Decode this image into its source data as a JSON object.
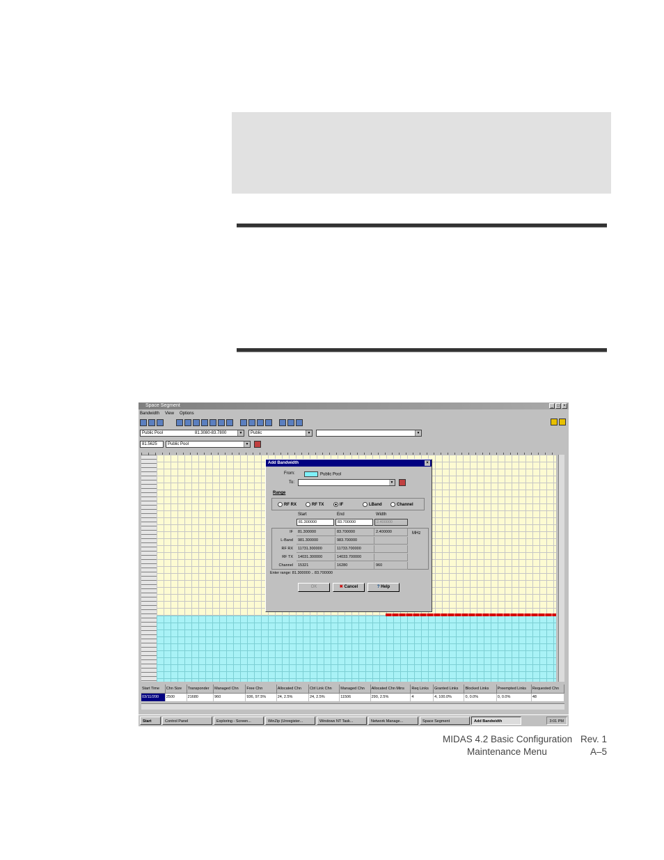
{
  "screenshot": {
    "window_title": "Space Segment",
    "menu": [
      "Bandwidth",
      "View",
      "Options"
    ],
    "pool_combo": "Public Pool",
    "pool_range": "81.3080-83.7800",
    "network_combo": "Public",
    "freq_field": "81.5625",
    "pool_combo2": "Public Pool",
    "dialog": {
      "title": "Add Bandwidth",
      "from_label": "From:",
      "from_value": "Public Pool",
      "to_label": "To:",
      "range_group": "Range",
      "radio_rfrx": "RF RX",
      "radio_rftx": "RF TX",
      "radio_if": "IF",
      "radio_lband": "LBand",
      "radio_channel": "Channel",
      "start_label": "Start",
      "end_label": "End",
      "width_label": "Width",
      "start_value": "81.300000",
      "end_value": "83.700000",
      "width_value": "2.400000",
      "rows": [
        {
          "label": "IF",
          "start": "81.300000",
          "end": "83.700000",
          "width": "2.400000"
        },
        {
          "label": "L-Band",
          "start": "981.300000",
          "end": "983.700000",
          "width": ""
        },
        {
          "label": "RF RX",
          "start": "11731.300000",
          "end": "11733.700000",
          "width": ""
        },
        {
          "label": "RF TX",
          "start": "14031.300000",
          "end": "14033.700000",
          "width": ""
        },
        {
          "label": "Channel",
          "start": "15321",
          "end": "16280",
          "width": "960"
        }
      ],
      "unit": "MHz",
      "enter_range": "Enter range: 81.300000 .. 83.700000",
      "ok_label": "OK",
      "cancel_label": "Cancel",
      "help_label": "Help"
    },
    "table": {
      "headers": [
        "Start Time",
        "Chn Size",
        "Transponder",
        "Managed Chn",
        "Free Chn",
        "Allocated Chn",
        "Ctrl Link Chn",
        "Managed Chn",
        "Allocated Chn Mins",
        "Req Links",
        "Granted Links",
        "Blocked Links",
        "Preempted Links",
        "Requested Chn"
      ],
      "row": [
        "03/11/200",
        "2500",
        "21680",
        "960",
        "936, 97.5%",
        "24, 2.5%",
        "24, 2.5%",
        "11506",
        "290, 2.5%",
        "4",
        "4, 100.0%",
        "0, 0.0%",
        "0, 0.0%",
        "48"
      ]
    },
    "taskbar": [
      "Start",
      "Control Panel",
      "Exploring - Screen...",
      "WinZip (Unregister...",
      "Windows NT Task...",
      "Network Manage...",
      "Space Segment",
      "Add Bandwidth"
    ],
    "clock": "3:01 PM"
  },
  "footer": {
    "doc_title": "MIDAS 4.2 Basic Configuration",
    "rev": "Rev. 1",
    "section": "Maintenance Menu",
    "page": "A–5"
  }
}
